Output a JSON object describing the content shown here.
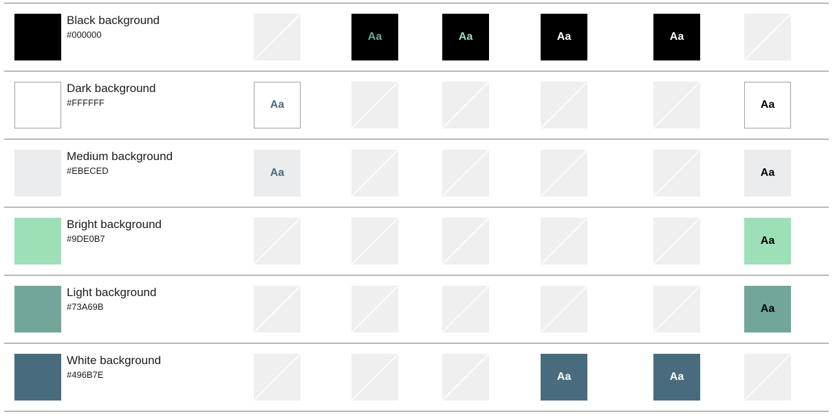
{
  "colors": {
    "empty_cell": "#EFEFEF",
    "divider": "#7A7A7A"
  },
  "rows": [
    {
      "name": "Black background",
      "hex": "#000000",
      "swatch_color": "#000000",
      "cells": [
        null,
        {
          "text": "Aa",
          "bg": "#000000",
          "fg": "#73A69B"
        },
        {
          "text": "Aa",
          "bg": "#000000",
          "fg": "#9DE0B7"
        },
        {
          "text": "Aa",
          "bg": "#000000",
          "fg": "#FFFFFF"
        },
        {
          "text": "Aa",
          "bg": "#000000",
          "fg": "#FFFFFF"
        },
        null
      ]
    },
    {
      "name": "Dark background",
      "hex": "#FFFFFF",
      "swatch_color": "#FFFFFF",
      "cells": [
        {
          "text": "Aa",
          "bg": "#FFFFFF",
          "fg": "#496B7E"
        },
        null,
        null,
        null,
        null,
        {
          "text": "Aa",
          "bg": "#FFFFFF",
          "fg": "#000000"
        }
      ]
    },
    {
      "name": "Medium background",
      "hex": "#EBECED",
      "swatch_color": "#EBECED",
      "cells": [
        {
          "text": "Aa",
          "bg": "#EBECED",
          "fg": "#496B7E"
        },
        null,
        null,
        null,
        null,
        {
          "text": "Aa",
          "bg": "#EBECED",
          "fg": "#000000"
        }
      ]
    },
    {
      "name": "Bright background",
      "hex": "#9DE0B7",
      "swatch_color": "#9DE0B7",
      "cells": [
        null,
        null,
        null,
        null,
        null,
        {
          "text": "Aa",
          "bg": "#9DE0B7",
          "fg": "#000000"
        }
      ]
    },
    {
      "name": "Light background",
      "hex": "#73A69B",
      "swatch_color": "#73A69B",
      "cells": [
        null,
        null,
        null,
        null,
        null,
        {
          "text": "Aa",
          "bg": "#73A69B",
          "fg": "#000000"
        }
      ]
    },
    {
      "name": "White background",
      "hex": "#496B7E",
      "swatch_color": "#496B7E",
      "cells": [
        null,
        null,
        null,
        {
          "text": "Aa",
          "bg": "#496B7E",
          "fg": "#FFFFFF"
        },
        {
          "text": "Aa",
          "bg": "#496B7E",
          "fg": "#FFFFFF"
        },
        null
      ]
    }
  ]
}
